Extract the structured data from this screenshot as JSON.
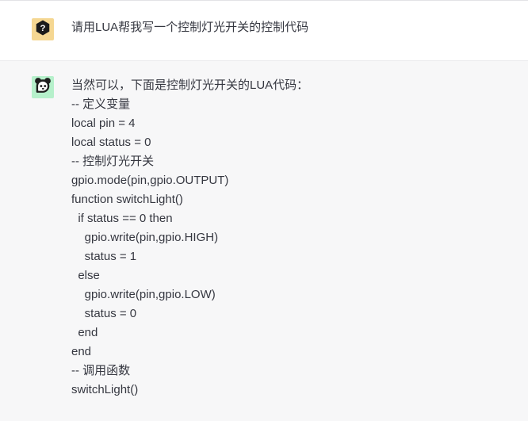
{
  "theme": {
    "page_background": "#ffffff",
    "assistant_background": "#f7f7f8",
    "text_color": "#353740",
    "user_avatar_background": "#f5d792",
    "assistant_avatar_background": "#b6f0cb",
    "divider_color": "#ececee"
  },
  "conversation": {
    "messages": [
      {
        "role": "user",
        "avatar_icon": "question-mark-hexagon-icon",
        "text": "请用LUA帮我写一个控制灯光开关的控制代码"
      },
      {
        "role": "assistant",
        "avatar_icon": "panda-chat-bubble-icon",
        "intro": "当然可以，下面是控制灯光开关的LUA代码：",
        "code_language": "lua",
        "code_lines": [
          "-- 定义变量",
          "local pin = 4",
          "local status = 0",
          "-- 控制灯光开关",
          "gpio.mode(pin,gpio.OUTPUT)",
          "function switchLight()",
          "  if status == 0 then",
          "    gpio.write(pin,gpio.HIGH)",
          "    status = 1",
          "  else",
          "    gpio.write(pin,gpio.LOW)",
          "    status = 0",
          "  end",
          "end",
          "-- 调用函数",
          "switchLight()"
        ]
      }
    ]
  }
}
